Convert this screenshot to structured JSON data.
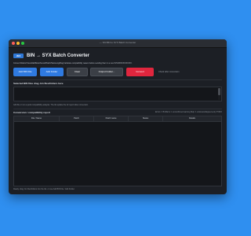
{
  "window": {
    "title": "— SN BIN to SYX Batch Converter"
  },
  "header": {
    "badge": "JB4",
    "title": "BIN → SYX Batch Converter",
    "subtitle": "Convert Roland Soundlab/Boss/Sound/Patch/Samsung/Flag hardware compatibility reason before sending them to a next SH-06XX/XX/XX/XX."
  },
  "toolbar": {
    "add_bin": "Add BIN File",
    "add_folder": "Add Folder",
    "clear": "Clear",
    "output_folder": "Output Folder...",
    "convert": "Convert",
    "status": "Check after conversion"
  },
  "files_section": {
    "label": "Selected BIN files   drag .bin files/folders here",
    "hint": "Add file or run a quick compatibility analysis. The list update the dir report after conversion."
  },
  "report": {
    "label": "Conversion / compatibility report",
    "summary": "Errors: 0 B    Warns: 1 unconfirmed warning    Skip: 1 unknown/skipped entry TODO",
    "columns": [
      "File / Name",
      "Patch",
      "Patch name",
      "Status",
      "Details"
    ]
  },
  "footer": {
    "text": "Ready. drag .bin files/folders into the list. or use Add BIN File / Add Folder."
  }
}
